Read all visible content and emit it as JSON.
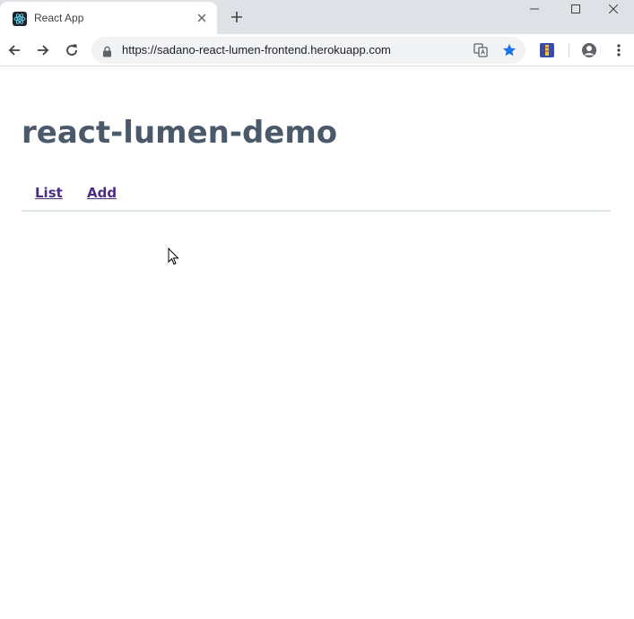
{
  "browser": {
    "tab_title": "React App",
    "url": "https://sadano-react-lumen-frontend.herokuapp.com"
  },
  "app": {
    "title": "react-lumen-demo",
    "nav": [
      {
        "label": "List"
      },
      {
        "label": "Add"
      }
    ]
  },
  "colors": {
    "title": "#4a5a6a",
    "link": "#4b2e83",
    "divider": "#dfe6e9",
    "star": "#1a73e8"
  }
}
